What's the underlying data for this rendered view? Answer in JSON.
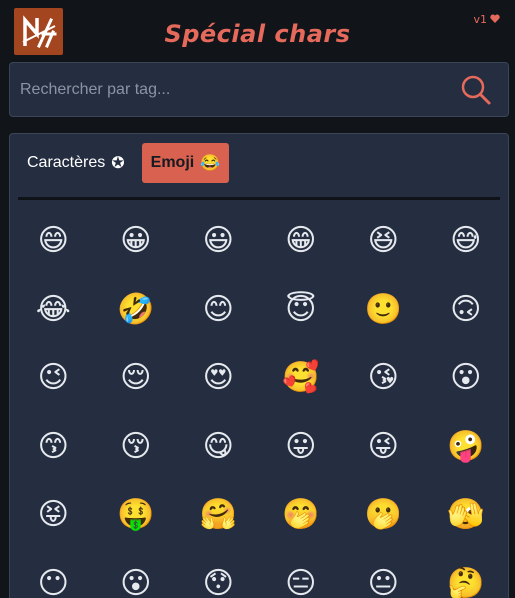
{
  "header": {
    "title": "Spécial chars",
    "version": "v1",
    "logo_icon": "logo-icon",
    "heart_icon": "heart-icon"
  },
  "search": {
    "placeholder": "Rechercher par tag...",
    "value": "",
    "icon": "search-icon"
  },
  "tabs": [
    {
      "label": "Caractères",
      "icon": "✪",
      "active": false
    },
    {
      "label": "Emoji",
      "icon": "😂",
      "active": true
    }
  ],
  "emojis": [
    "😄",
    "😀",
    "😃",
    "😁",
    "😆",
    "😅",
    "😂",
    "🤣",
    "😊",
    "😇",
    "🙂",
    "🙃",
    "😉",
    "😌",
    "😍",
    "🥰",
    "😘",
    "😮",
    "😙",
    "😚",
    "😋",
    "😛",
    "😜",
    "🤪",
    "😝",
    "🤑",
    "🤗",
    "🤭",
    "🫢",
    "🫣",
    "😶",
    "😮",
    "😯",
    "😑",
    "😐",
    "🤔"
  ],
  "colors": {
    "accent": "#e56a5c",
    "active_tab": "#d9614f",
    "panel": "#242e40",
    "background": "#111419"
  }
}
